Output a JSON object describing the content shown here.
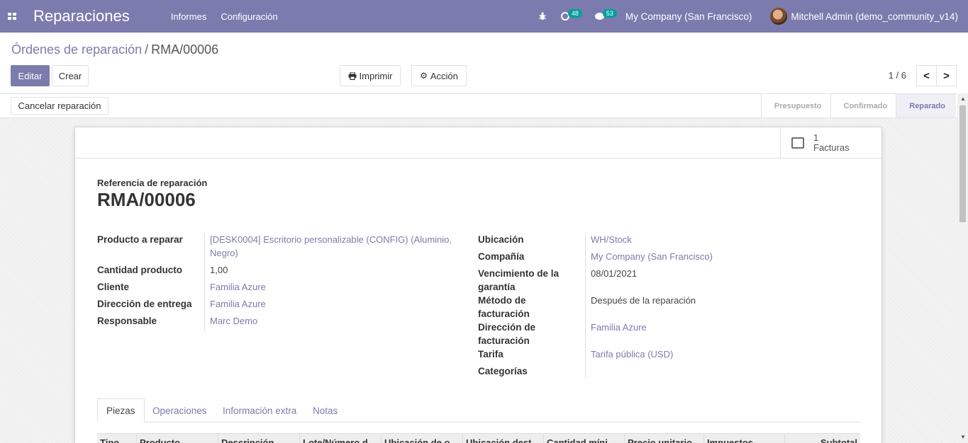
{
  "navbar": {
    "app_title": "Reparaciones",
    "menu": [
      "Informes",
      "Configuración"
    ],
    "activity_count": "48",
    "messages_count": "53",
    "company": "My Company (San Francisco)",
    "user": "Mitchell Admin (demo_community_v14)"
  },
  "breadcrumb": {
    "parent": "Órdenes de reparación",
    "separator": "/",
    "current": "RMA/00006"
  },
  "actions": {
    "edit": "Editar",
    "create": "Crear",
    "print": "Imprimir",
    "action": "Acción",
    "pager": "1 / 6",
    "prev": "<",
    "next": ">"
  },
  "statusbar": {
    "cancel": "Cancelar reparación",
    "steps": [
      "Presupuesto",
      "Confirmado",
      "Reparado"
    ],
    "active_step": "Reparado"
  },
  "smart_button": {
    "count": "1",
    "label": "Facturas"
  },
  "form": {
    "ref_label": "Referencia de reparación",
    "ref_value": "RMA/00006",
    "left": [
      {
        "label": "Producto a reparar",
        "value": "[DESK0004] Escritorio personalizable (CONFIG) (Aluminio, Negro)",
        "link": true
      },
      {
        "label": "Cantidad producto",
        "value": "1,00",
        "link": false
      },
      {
        "label": "Cliente",
        "value": "Familia Azure",
        "link": true
      },
      {
        "label": "Dirección de entrega",
        "value": "Familia Azure",
        "link": true
      },
      {
        "label": "Responsable",
        "value": "Marc Demo",
        "link": true
      }
    ],
    "right": [
      {
        "label": "Ubicación",
        "value": "WH/Stock",
        "link": true
      },
      {
        "label": "Compañía",
        "value": "My Company (San Francisco)",
        "link": true
      },
      {
        "label": "Vencimiento de la garantía",
        "value": "08/01/2021",
        "link": false
      },
      {
        "label": "Método de facturación",
        "value": "Después de la reparación",
        "link": false
      },
      {
        "label": "Dirección de facturación",
        "value": "Familia Azure",
        "link": true
      },
      {
        "label": "Tarifa",
        "value": "Tarifa pública (USD)",
        "link": true
      },
      {
        "label": "Categorías",
        "value": "",
        "link": false
      }
    ]
  },
  "tabs": [
    "Piezas",
    "Operaciones",
    "Información extra",
    "Notas"
  ],
  "table_headers": [
    "Tipo",
    "Producto",
    "Descripción",
    "Lote/Número d",
    "Ubicación de o",
    "Ubicación dest",
    "Cantidad míni",
    "Precio unitario",
    "Impuestos",
    "Subtotal"
  ],
  "colors": {
    "brand": "#7c7bad",
    "badge": "#00a09d"
  }
}
